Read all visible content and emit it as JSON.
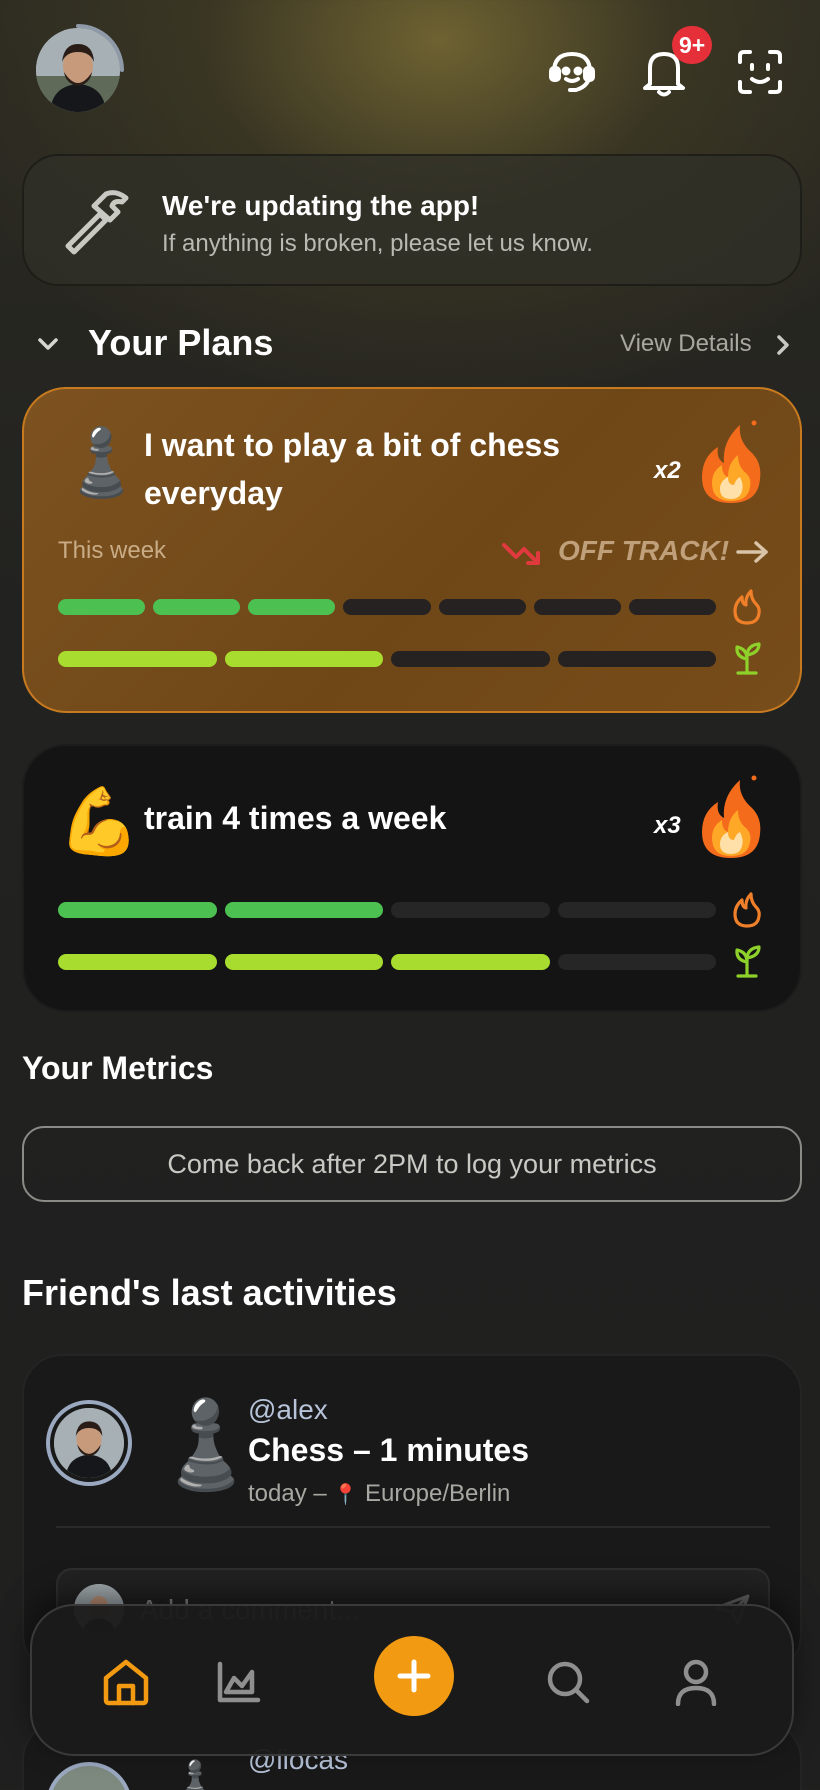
{
  "header": {
    "notification_count": "9+",
    "icons": [
      "support-icon",
      "bell-icon",
      "face-scan-icon"
    ]
  },
  "banner": {
    "title": "We're updating the app!",
    "subtitle": "If anything is broken, please let us know.",
    "icon": "hammer-icon"
  },
  "plans": {
    "title": "Your Plans",
    "view_details": "View Details",
    "items": [
      {
        "emoji": "♟️",
        "title": "I want to play a bit of chess everyday",
        "streak": "x2",
        "week_label": "This week",
        "status": "OFF TRACK!",
        "status_color": "#e0393e",
        "accent": "#f29a12",
        "progress_rows": [
          {
            "icon": "flame-outline-icon",
            "filled": 3,
            "total": 7,
            "color": "#4cc152"
          },
          {
            "icon": "sprout-icon",
            "filled": 2,
            "total": 4,
            "color": "#a8dc2e"
          }
        ]
      },
      {
        "emoji": "💪",
        "title": "train 4 times a week",
        "streak": "x3",
        "progress_rows": [
          {
            "icon": "flame-outline-icon",
            "filled": 2,
            "total": 4,
            "color": "#4cc152"
          },
          {
            "icon": "sprout-icon",
            "filled": 3,
            "total": 4,
            "color": "#a8dc2e"
          }
        ]
      }
    ]
  },
  "metrics": {
    "title": "Your Metrics",
    "message": "Come back after 2PM to log your metrics"
  },
  "friends": {
    "title": "Friend's last activities",
    "activities": [
      {
        "username": "@alex",
        "emoji": "♟️",
        "activity": "Chess – 1 minutes",
        "when": "today –",
        "location_pin": "📍",
        "location": "Europe/Berlin",
        "comment_placeholder": "Add a comment..."
      },
      {
        "username": "@liocas",
        "emoji": "♟️"
      }
    ]
  },
  "bottom_nav": {
    "items": [
      "home-icon",
      "chart-icon",
      "add-icon",
      "search-icon",
      "profile-icon"
    ],
    "active": "home-icon",
    "accent": "#f29a12"
  }
}
